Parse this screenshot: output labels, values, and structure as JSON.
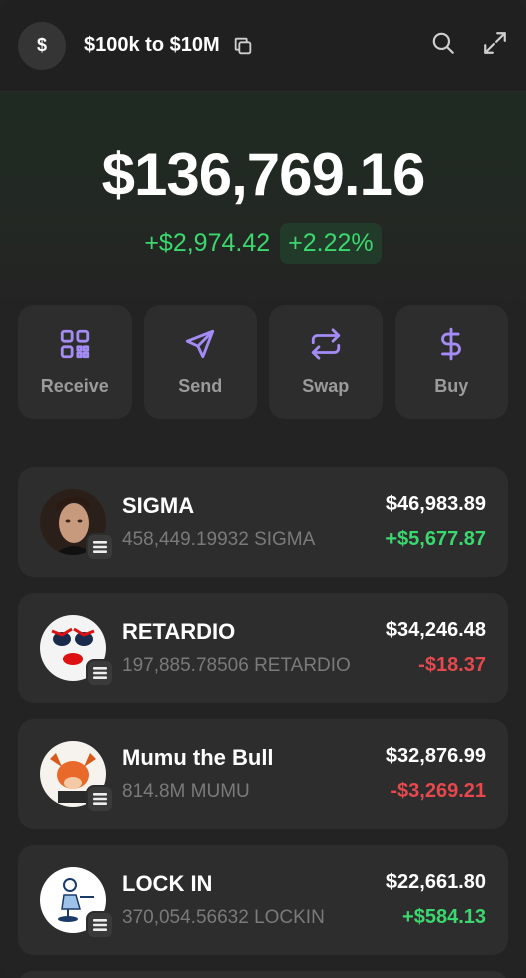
{
  "header": {
    "avatar_symbol": "$",
    "wallet_name": "$100k to $10M",
    "icons": [
      "copy-icon",
      "search-icon",
      "expand-icon"
    ]
  },
  "balance": {
    "total": "$136,769.16",
    "change_abs": "+$2,974.42",
    "change_pct": "+2.22%"
  },
  "actions": [
    {
      "label": "Receive",
      "icon": "qr-code-icon"
    },
    {
      "label": "Send",
      "icon": "send-icon"
    },
    {
      "label": "Swap",
      "icon": "swap-icon"
    },
    {
      "label": "Buy",
      "icon": "dollar-icon"
    }
  ],
  "tokens": [
    {
      "name": "SIGMA",
      "amount": "458,449.19932 SIGMA",
      "value": "$46,983.89",
      "change": "+$5,677.87",
      "direction": "up"
    },
    {
      "name": "RETARDIO",
      "amount": "197,885.78506 RETARDIO",
      "value": "$34,246.48",
      "change": "-$18.37",
      "direction": "down"
    },
    {
      "name": "Mumu the Bull",
      "amount": "814.8M MUMU",
      "value": "$32,876.99",
      "change": "-$3,269.21",
      "direction": "down"
    },
    {
      "name": "LOCK IN",
      "amount": "370,054.56632 LOCKIN",
      "value": "$22,661.80",
      "change": "+$584.13",
      "direction": "up"
    }
  ],
  "colors": {
    "accent": "#a48bf5",
    "positive": "#3ad86e",
    "negative": "#e5484d",
    "card": "#2d2d2d"
  }
}
